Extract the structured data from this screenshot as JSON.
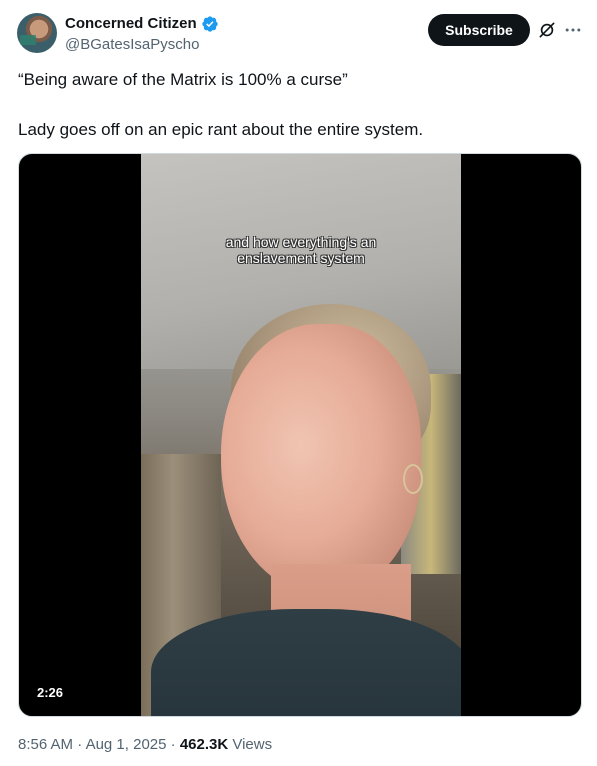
{
  "author": {
    "display_name": "Concerned Citizen",
    "handle": "@BGatesIsaPyscho",
    "verified_icon": "verified-badge-icon"
  },
  "actions": {
    "subscribe_label": "Subscribe",
    "grok_icon": "grok-icon",
    "more_icon": "more-icon"
  },
  "tweet": {
    "line1": "“Being aware of the Matrix is 100% a curse”",
    "line2": "Lady goes off on an epic rant about the entire system."
  },
  "video": {
    "caption_line1": "and how everything's an",
    "caption_line2": "enslavement system",
    "duration": "2:26"
  },
  "meta": {
    "time": "8:56 AM",
    "separator1": " · ",
    "date": "Aug 1, 2025",
    "separator2": " · ",
    "views_count": "462.3K",
    "views_label": " Views"
  },
  "colors": {
    "verified_blue": "#1d9bf0",
    "text_primary": "#0f1419",
    "text_secondary": "#536471"
  }
}
